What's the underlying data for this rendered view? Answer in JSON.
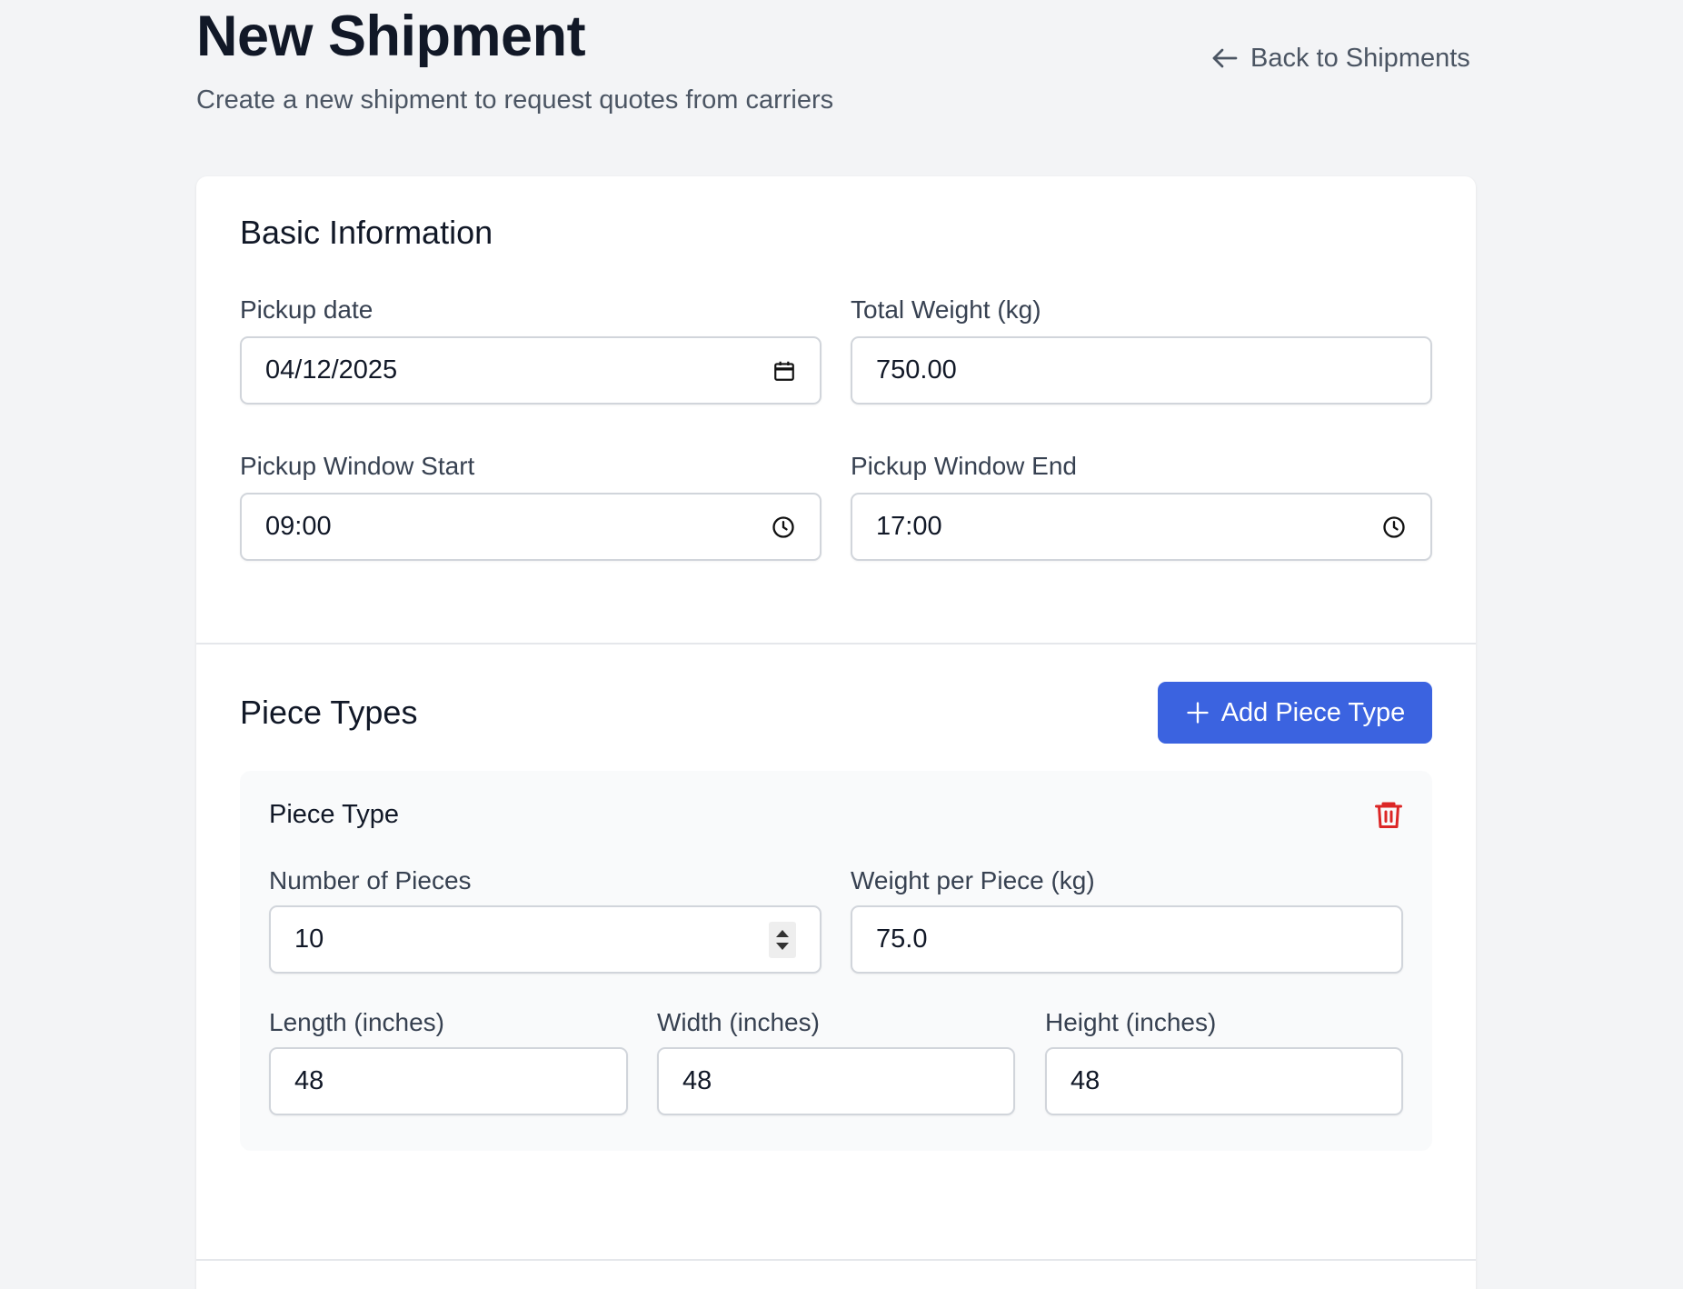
{
  "header": {
    "title": "New Shipment",
    "subtitle": "Create a new shipment to request quotes from carriers",
    "back_label": "Back to Shipments"
  },
  "basic": {
    "title": "Basic Information",
    "pickup_date": {
      "label": "Pickup date",
      "value": "04/12/2025"
    },
    "total_weight": {
      "label": "Total Weight (kg)",
      "value": "750.00"
    },
    "window_start": {
      "label": "Pickup Window Start",
      "value": "09:00"
    },
    "window_end": {
      "label": "Pickup Window End",
      "value": "17:00"
    }
  },
  "pieces": {
    "title": "Piece Types",
    "add_label": "Add Piece Type",
    "items": [
      {
        "title": "Piece Type",
        "count": {
          "label": "Number of Pieces",
          "value": "10"
        },
        "weight": {
          "label": "Weight per Piece (kg)",
          "value": "75.0"
        },
        "length": {
          "label": "Length (inches)",
          "value": "48"
        },
        "width": {
          "label": "Width (inches)",
          "value": "48"
        },
        "height": {
          "label": "Height (inches)",
          "value": "48"
        }
      }
    ]
  },
  "colors": {
    "primary": "#3b63e0",
    "danger": "#dc2626",
    "background": "#f3f4f6"
  },
  "icons": [
    "arrow-left-icon",
    "calendar-icon",
    "clock-icon",
    "plus-icon",
    "trash-icon"
  ]
}
